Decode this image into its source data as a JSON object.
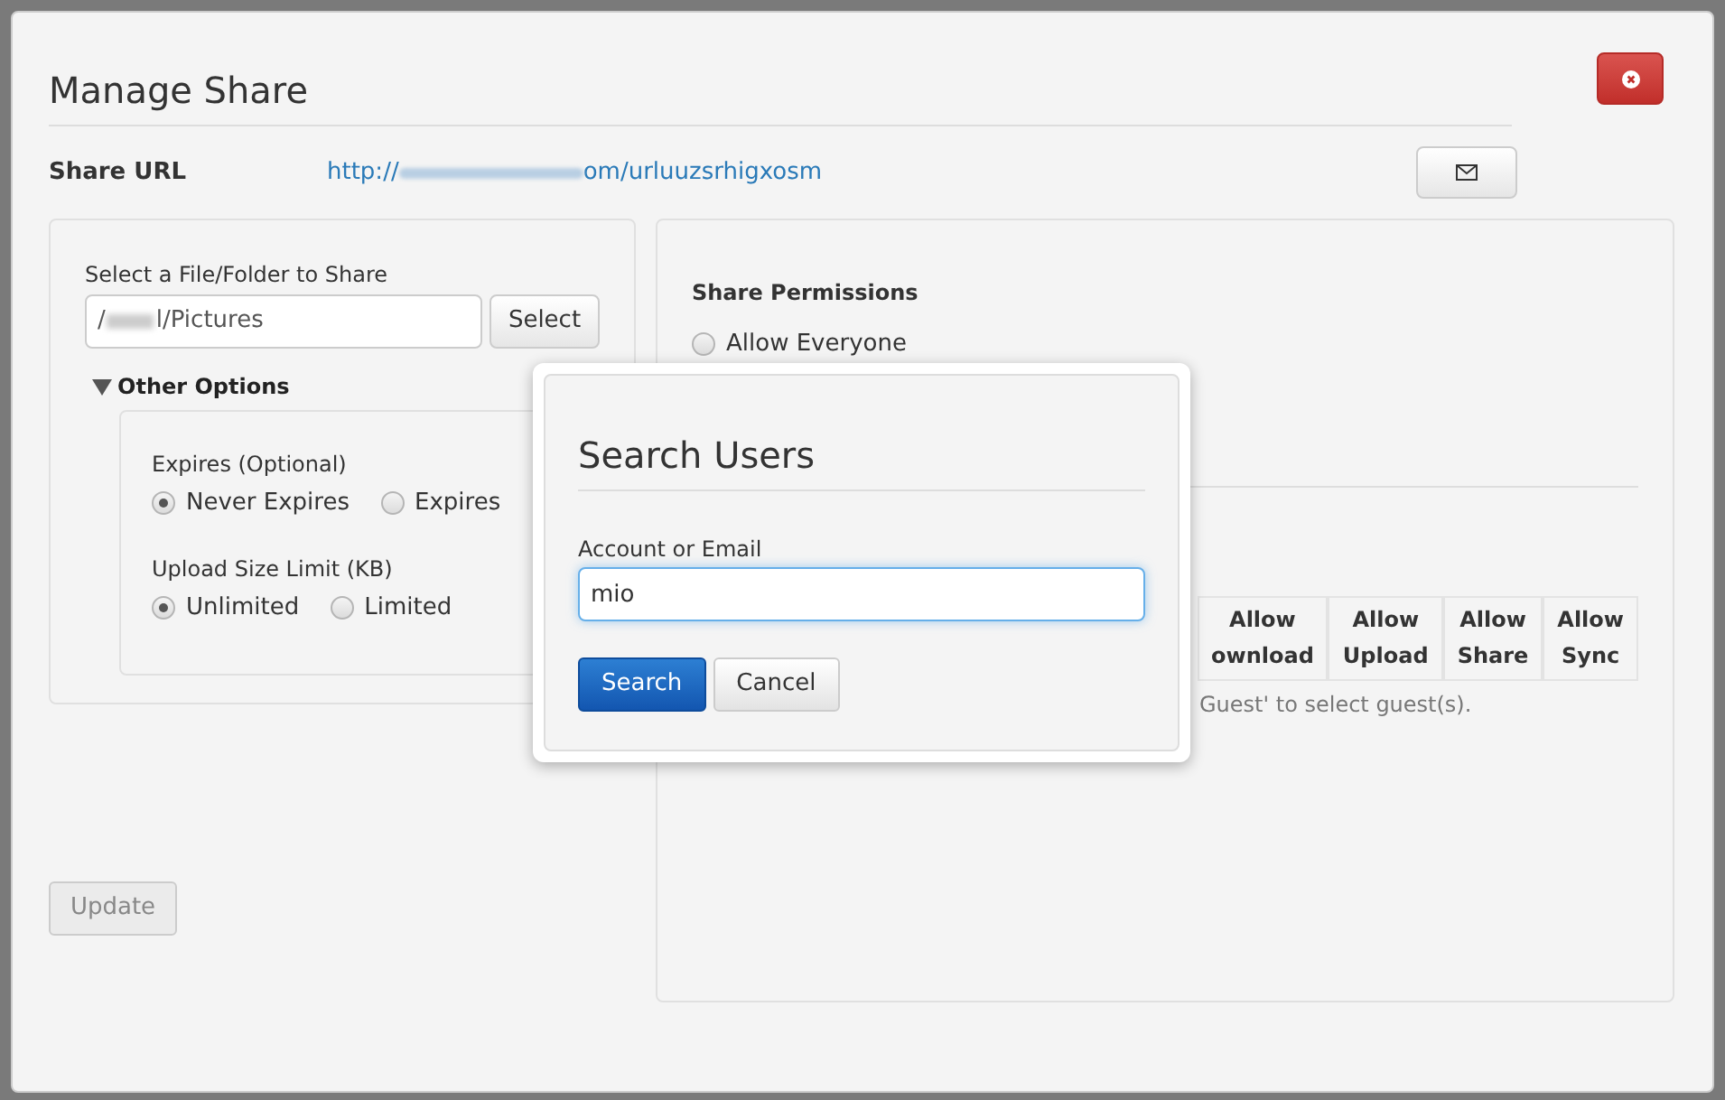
{
  "title": "Manage Share",
  "share_url": {
    "label": "Share URL",
    "url_start": "http://",
    "url_end": "om/urluuzsrhigxosm"
  },
  "file_select": {
    "label": "Select a File/Folder to Share",
    "value_start": "/",
    "value_end": "l/Pictures",
    "button": "Select"
  },
  "other_options": {
    "label": "Other Options",
    "expanded": true,
    "groups": [
      {
        "label": "Expires (Optional)",
        "options": [
          {
            "label": "Never Expires",
            "selected": true
          },
          {
            "label": "Expires",
            "selected": false
          }
        ]
      },
      {
        "label": "Upload Size Limit (KB)",
        "options": [
          {
            "label": "Unlimited",
            "selected": true
          },
          {
            "label": "Limited",
            "selected": false
          }
        ]
      }
    ]
  },
  "update_button": {
    "label": "Update",
    "disabled": true
  },
  "permissions": {
    "title": "Share Permissions",
    "options": [
      {
        "label": "Allow Everyone",
        "selected": false
      }
    ],
    "columns": [
      [
        "Allow",
        "ownload"
      ],
      [
        "Allow",
        "Upload"
      ],
      [
        "Allow",
        "Share"
      ],
      [
        "Allow",
        "Sync"
      ]
    ],
    "hint": "Guest' to select guest(s)."
  },
  "search_dialog": {
    "title": "Search Users",
    "field_label": "Account or Email",
    "value": "mio",
    "buttons": [
      {
        "label": "Search",
        "kind": "primary"
      },
      {
        "label": "Cancel",
        "kind": "default"
      }
    ]
  }
}
